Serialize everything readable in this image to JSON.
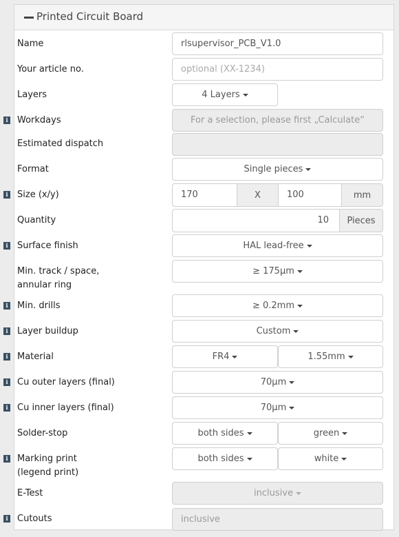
{
  "panel": {
    "title": "Printed Circuit Board"
  },
  "icons": {
    "info": "i"
  },
  "rows": {
    "name": {
      "label": "Name",
      "value": "rlsupervisor_PCB_V1.0"
    },
    "article": {
      "label": "Your article no.",
      "placeholder": "optional (XX-1234)"
    },
    "layers": {
      "label": "Layers",
      "value": "4 Layers"
    },
    "workdays": {
      "label": "Workdays",
      "value": "For a selection, please first „Calculate“"
    },
    "dispatch": {
      "label": "Estimated dispatch",
      "value": ""
    },
    "format": {
      "label": "Format",
      "value": "Single pieces"
    },
    "size": {
      "label": "Size (x/y)",
      "x": "170",
      "sep": "X",
      "y": "100",
      "unit": "mm"
    },
    "quantity": {
      "label": "Quantity",
      "value": "10",
      "unit": "Pieces"
    },
    "surface": {
      "label": "Surface finish",
      "value": "HAL lead-free"
    },
    "track": {
      "label_line1": "Min. track / space,",
      "label_line2": "annular ring",
      "value": "≥ 175µm"
    },
    "drills": {
      "label": "Min. drills",
      "value": "≥ 0.2mm"
    },
    "buildup": {
      "label": "Layer buildup",
      "value": "Custom"
    },
    "material": {
      "label": "Material",
      "value": "FR4",
      "thickness": "1.55mm"
    },
    "cu_outer": {
      "label": "Cu outer layers (final)",
      "value": "70µm"
    },
    "cu_inner": {
      "label": "Cu inner layers (final)",
      "value": "70µm"
    },
    "solder": {
      "label": "Solder-stop",
      "sides": "both sides",
      "color": "green"
    },
    "marking": {
      "label_line1": "Marking print",
      "label_line2": "(legend print)",
      "sides": "both sides",
      "color": "white"
    },
    "etest": {
      "label": "E-Test",
      "value": "inclusive"
    },
    "cutouts": {
      "label": "Cutouts",
      "value": "inclusive"
    }
  }
}
